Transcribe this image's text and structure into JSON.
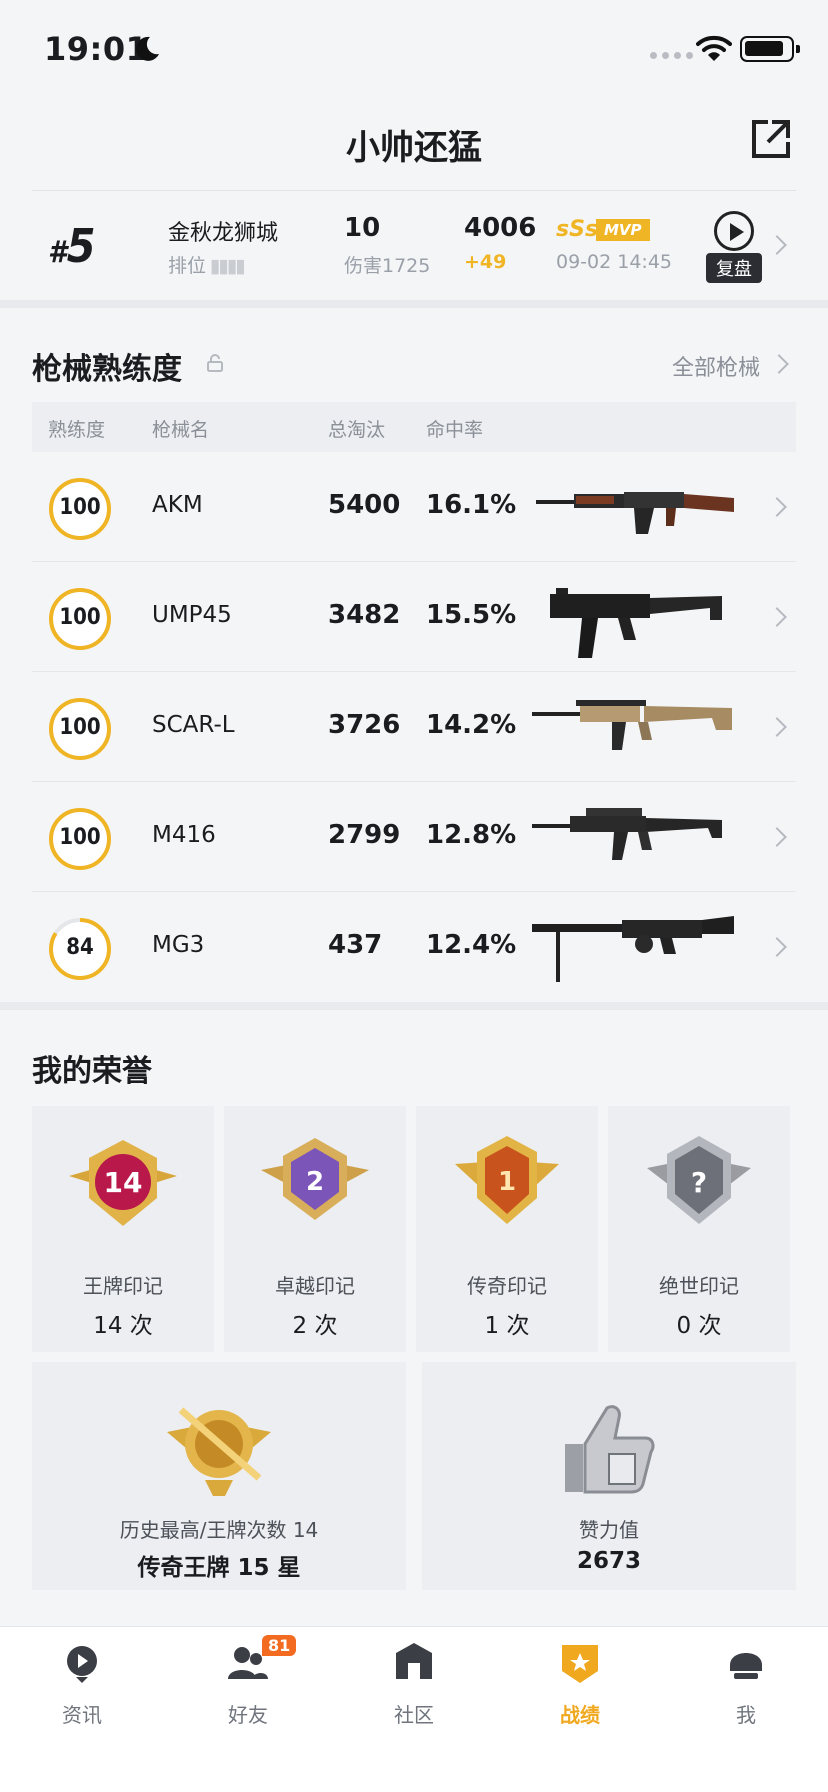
{
  "status_bar": {
    "time": "19:01"
  },
  "header": {
    "title": "小帅还猛"
  },
  "match": {
    "rank_prefix": "#",
    "rank": "5",
    "map": "金秋龙狮城",
    "mode": "排位",
    "kills": "10",
    "damage": "伤害1725",
    "score": "4006",
    "score_delta": "+49",
    "grade": "sSs",
    "mvp": "MVP",
    "datetime": "09-02 14:45",
    "replay_label": "复盘"
  },
  "weapons": {
    "title": "枪械熟练度",
    "all_link": "全部枪械",
    "columns": {
      "mastery": "熟练度",
      "name": "枪械名",
      "kills": "总淘汰",
      "accuracy": "命中率"
    },
    "rows": [
      {
        "mastery": "100",
        "mastery_pct": 100,
        "name": "AKM",
        "kills": "5400",
        "accuracy": "16.1%"
      },
      {
        "mastery": "100",
        "mastery_pct": 100,
        "name": "UMP45",
        "kills": "3482",
        "accuracy": "15.5%"
      },
      {
        "mastery": "100",
        "mastery_pct": 100,
        "name": "SCAR-L",
        "kills": "3726",
        "accuracy": "14.2%"
      },
      {
        "mastery": "100",
        "mastery_pct": 100,
        "name": "M416",
        "kills": "2799",
        "accuracy": "12.8%"
      },
      {
        "mastery": "84",
        "mastery_pct": 84,
        "name": "MG3",
        "kills": "437",
        "accuracy": "12.4%"
      }
    ]
  },
  "honors": {
    "title": "我的荣誉",
    "badges": [
      {
        "name": "王牌印记",
        "count": "14 次",
        "badge_text": "14"
      },
      {
        "name": "卓越印记",
        "count": "2 次",
        "badge_text": "2"
      },
      {
        "name": "传奇印记",
        "count": "1 次",
        "badge_text": "1"
      },
      {
        "name": "绝世印记",
        "count": "0 次",
        "badge_text": "?"
      }
    ],
    "best": {
      "label": "历史最高/王牌次数 14",
      "value": "传奇王牌 15 星"
    },
    "likes": {
      "label": "赞力值",
      "value": "2673"
    }
  },
  "tabbar": {
    "tabs": [
      {
        "label": "资讯",
        "icon": "news-icon"
      },
      {
        "label": "好友",
        "icon": "friends-icon",
        "badge": "81"
      },
      {
        "label": "社区",
        "icon": "community-icon"
      },
      {
        "label": "战绩",
        "icon": "record-icon",
        "active": true
      },
      {
        "label": "我",
        "icon": "profile-icon"
      }
    ]
  },
  "colors": {
    "accent": "#f0b524",
    "active_tab": "#f0a81e",
    "badge": "#f26b21"
  }
}
